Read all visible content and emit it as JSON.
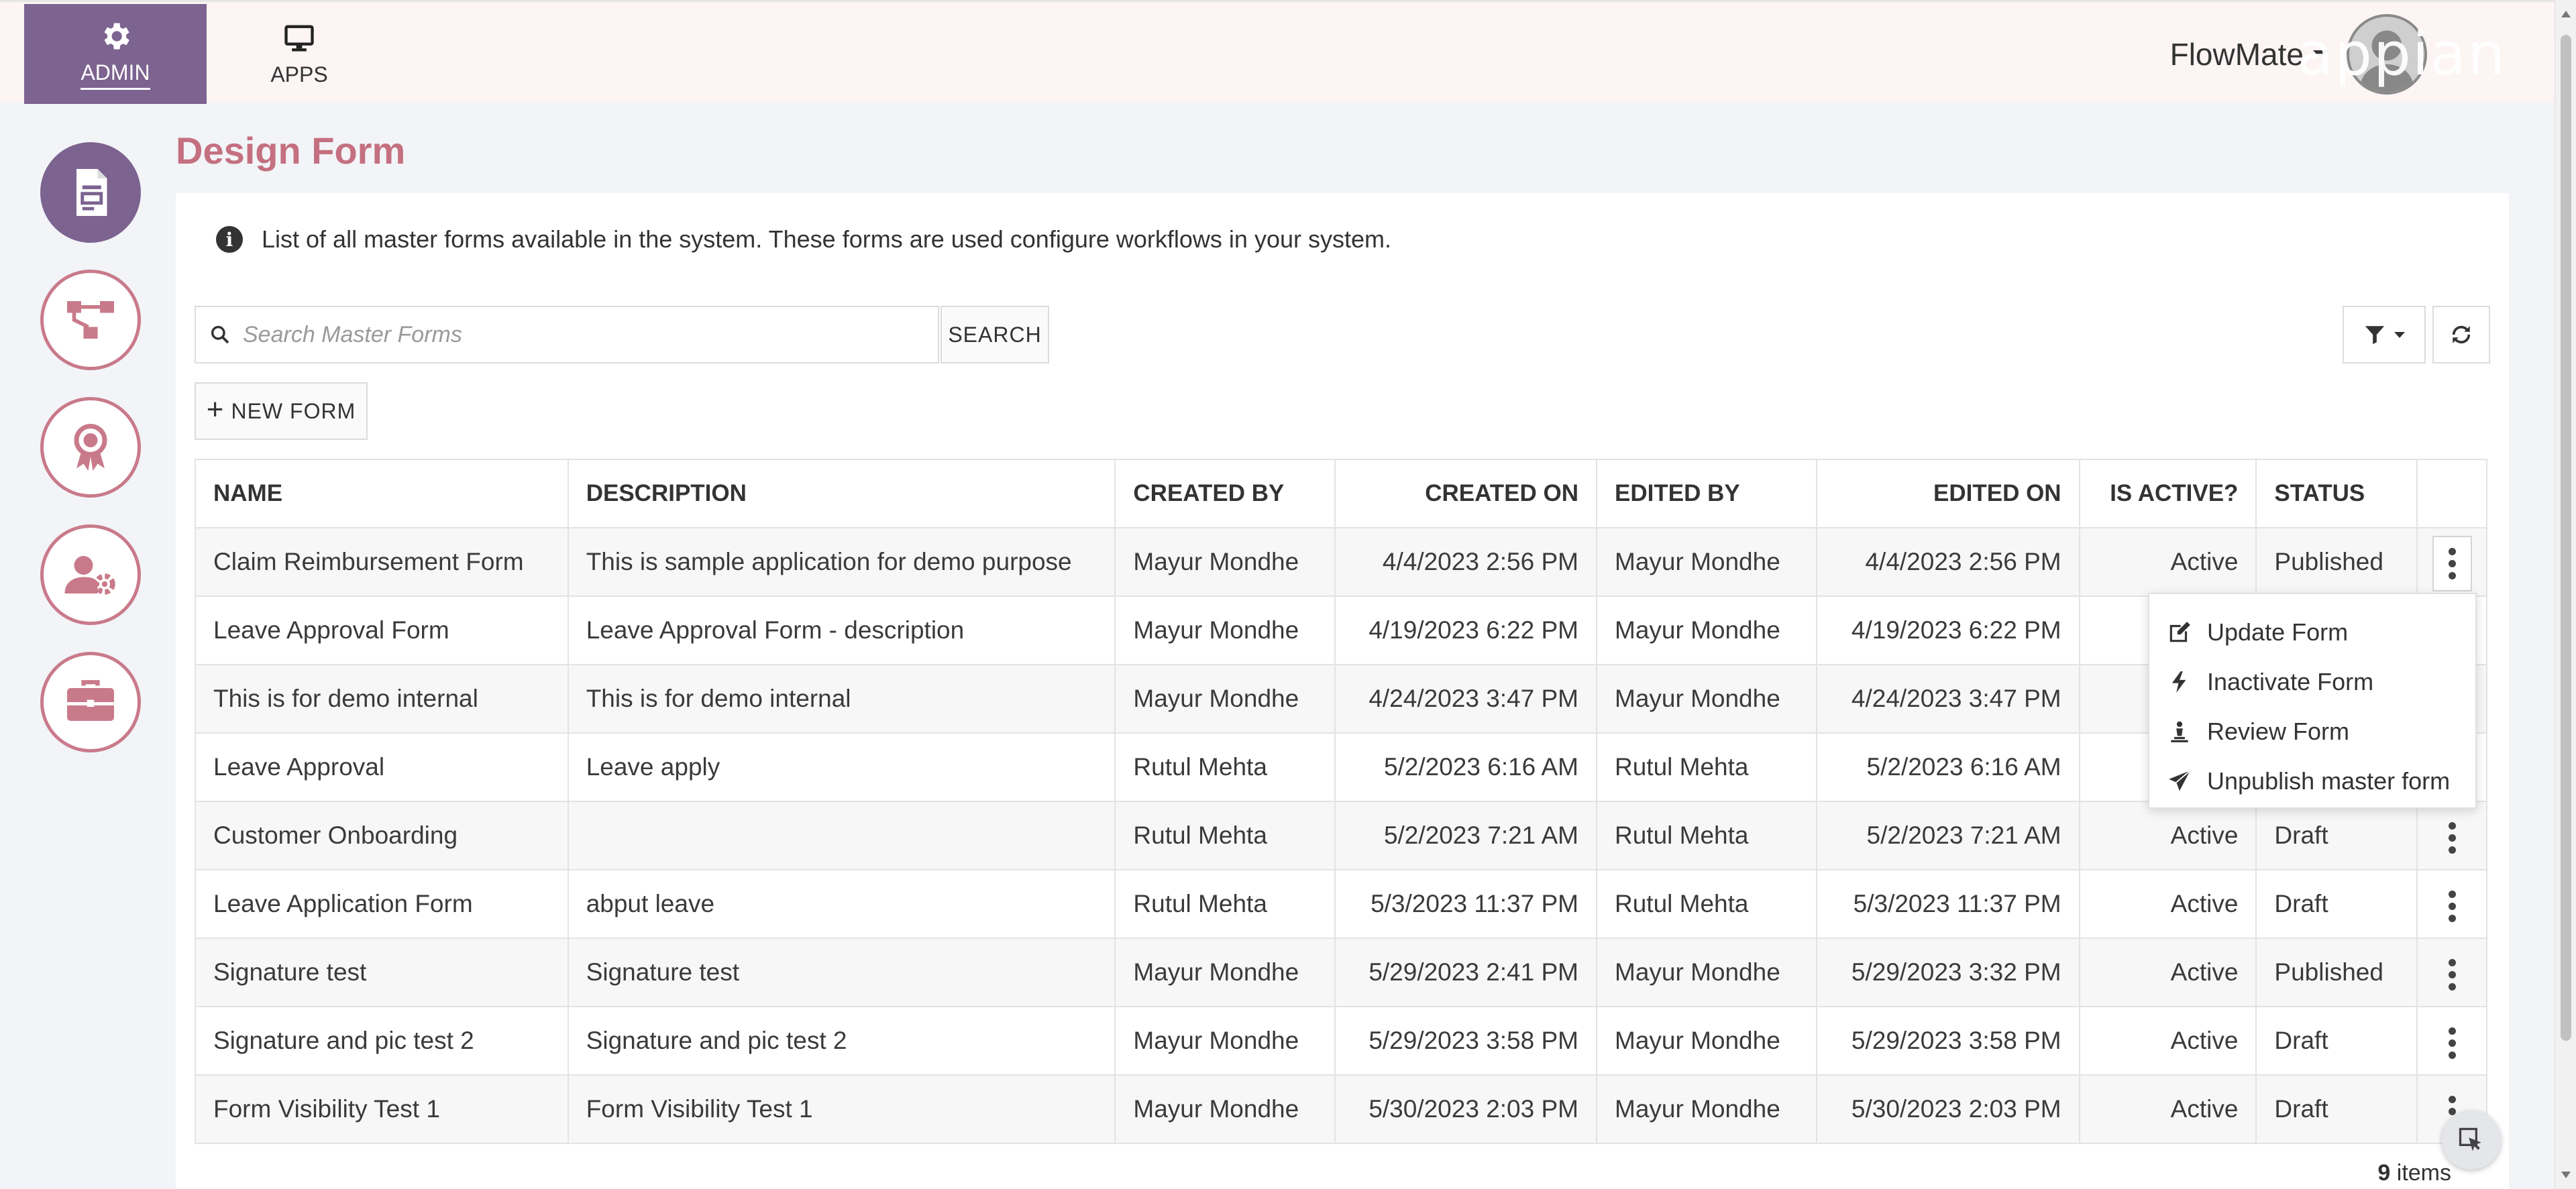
{
  "header": {
    "tabs": [
      {
        "label": "ADMIN",
        "icon": "gear-icon",
        "active": true
      },
      {
        "label": "APPS",
        "icon": "monitor-icon",
        "active": false
      }
    ],
    "user_name": "FlowMate",
    "brand": "appian"
  },
  "sidebar": {
    "items": [
      {
        "icon": "form-document-icon",
        "active": true
      },
      {
        "icon": "workflow-icon",
        "active": false
      },
      {
        "icon": "award-icon",
        "active": false
      },
      {
        "icon": "user-settings-icon",
        "active": false
      },
      {
        "icon": "briefcase-icon",
        "active": false
      }
    ]
  },
  "page": {
    "title": "Design Form",
    "info": "List of all master forms available in the system. These forms are used configure workflows in your system."
  },
  "toolbar": {
    "search_placeholder": "Search Master Forms",
    "search_label": "SEARCH",
    "new_form_label": "NEW FORM"
  },
  "table": {
    "columns": [
      "NAME",
      "DESCRIPTION",
      "CREATED BY",
      "CREATED ON",
      "EDITED BY",
      "EDITED ON",
      "IS ACTIVE?",
      "STATUS"
    ],
    "rows": [
      {
        "name": "Claim Reimbursement Form",
        "description": "This is sample application for demo purpose",
        "created_by": "Mayur Mondhe",
        "created_on": "4/4/2023 2:56 PM",
        "edited_by": "Mayur Mondhe",
        "edited_on": "4/4/2023 2:56 PM",
        "is_active": "Active",
        "status": "Published"
      },
      {
        "name": "Leave Approval Form",
        "description": "Leave Approval Form - description",
        "created_by": "Mayur Mondhe",
        "created_on": "4/19/2023 6:22 PM",
        "edited_by": "Mayur Mondhe",
        "edited_on": "4/19/2023 6:22 PM",
        "is_active": "",
        "status": ""
      },
      {
        "name": "This is for demo internal",
        "description": "This is for demo internal",
        "created_by": "Mayur Mondhe",
        "created_on": "4/24/2023 3:47 PM",
        "edited_by": "Mayur Mondhe",
        "edited_on": "4/24/2023 3:47 PM",
        "is_active": "",
        "status": ""
      },
      {
        "name": "Leave Approval",
        "description": "Leave apply",
        "created_by": "Rutul Mehta",
        "created_on": "5/2/2023 6:16 AM",
        "edited_by": "Rutul Mehta",
        "edited_on": "5/2/2023 6:16 AM",
        "is_active": "",
        "status": ""
      },
      {
        "name": "Customer Onboarding",
        "description": "",
        "created_by": "Rutul Mehta",
        "created_on": "5/2/2023 7:21 AM",
        "edited_by": "Rutul Mehta",
        "edited_on": "5/2/2023 7:21 AM",
        "is_active": "Active",
        "status": "Draft"
      },
      {
        "name": "Leave Application Form",
        "description": "abput leave",
        "created_by": "Rutul Mehta",
        "created_on": "5/3/2023 11:37 PM",
        "edited_by": "Rutul Mehta",
        "edited_on": "5/3/2023 11:37 PM",
        "is_active": "Active",
        "status": "Draft"
      },
      {
        "name": "Signature test",
        "description": "Signature test",
        "created_by": "Mayur Mondhe",
        "created_on": "5/29/2023 2:41 PM",
        "edited_by": "Mayur Mondhe",
        "edited_on": "5/29/2023 3:32 PM",
        "is_active": "Active",
        "status": "Published"
      },
      {
        "name": "Signature and pic test 2",
        "description": "Signature and pic test 2",
        "created_by": "Mayur Mondhe",
        "created_on": "5/29/2023 3:58 PM",
        "edited_by": "Mayur Mondhe",
        "edited_on": "5/29/2023 3:58 PM",
        "is_active": "Active",
        "status": "Draft"
      },
      {
        "name": "Form Visibility Test 1",
        "description": "Form Visibility Test 1",
        "created_by": "Mayur Mondhe",
        "created_on": "5/30/2023 2:03 PM",
        "edited_by": "Mayur Mondhe",
        "edited_on": "5/30/2023 2:03 PM",
        "is_active": "Active",
        "status": "Draft"
      }
    ],
    "total_count": "9",
    "total_suffix": "items"
  },
  "context_menu": {
    "items": [
      {
        "label": "Update Form",
        "icon": "edit-icon"
      },
      {
        "label": "Inactivate Form",
        "icon": "bolt-icon"
      },
      {
        "label": "Review Form",
        "icon": "review-icon"
      },
      {
        "label": "Unpublish master form",
        "icon": "send-icon"
      }
    ]
  },
  "colors": {
    "accent_purple": "#7d6390",
    "title_rose": "#c47080",
    "sidebar_border": "#c97a8a"
  }
}
